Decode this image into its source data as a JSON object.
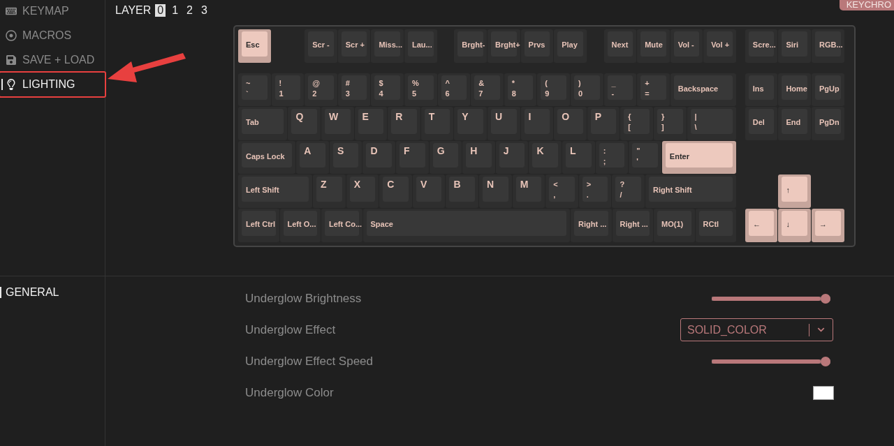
{
  "sidebar": {
    "items": [
      {
        "label": "KEYMAP",
        "selected": false,
        "annotated": false
      },
      {
        "label": "MACROS",
        "selected": false,
        "annotated": false
      },
      {
        "label": "SAVE + LOAD",
        "selected": false,
        "annotated": false
      },
      {
        "label": "LIGHTING",
        "selected": true,
        "annotated": true
      }
    ]
  },
  "layer_picker": {
    "label": "LAYER",
    "layers": [
      {
        "label": "0",
        "selected": true
      },
      {
        "label": "1",
        "selected": false
      },
      {
        "label": "2",
        "selected": false
      },
      {
        "label": "3",
        "selected": false
      }
    ]
  },
  "badge": "KEYCHRO",
  "keyboard": {
    "keys": [
      {
        "kind": "text",
        "legend": "Esc",
        "accent": true
      },
      {
        "kind": "text",
        "legend": "Scr -",
        "accent": false
      },
      {
        "kind": "text",
        "legend": "Scr +",
        "accent": false
      },
      {
        "kind": "text",
        "legend": "Miss...",
        "accent": false
      },
      {
        "kind": "text",
        "legend": "Lau...",
        "accent": false
      },
      {
        "kind": "text",
        "legend": "Brght-",
        "accent": false
      },
      {
        "kind": "text",
        "legend": "Brght+",
        "accent": false
      },
      {
        "kind": "text",
        "legend": "Prvs",
        "accent": false
      },
      {
        "kind": "text",
        "legend": "Play",
        "accent": false
      },
      {
        "kind": "text",
        "legend": "Next",
        "accent": false
      },
      {
        "kind": "text",
        "legend": "Mute",
        "accent": false
      },
      {
        "kind": "text",
        "legend": "Vol -",
        "accent": false
      },
      {
        "kind": "text",
        "legend": "Vol +",
        "accent": false
      },
      {
        "kind": "text",
        "legend": "Scre...",
        "accent": false
      },
      {
        "kind": "text",
        "legend": "Siri",
        "accent": false
      },
      {
        "kind": "text",
        "legend": "RGB...",
        "accent": false
      },
      {
        "kind": "dual",
        "shift": "~",
        "legend": "`",
        "accent": false
      },
      {
        "kind": "dual",
        "shift": "!",
        "legend": "1",
        "accent": false
      },
      {
        "kind": "dual",
        "shift": "@",
        "legend": "2",
        "accent": false
      },
      {
        "kind": "dual",
        "shift": "#",
        "legend": "3",
        "accent": false
      },
      {
        "kind": "dual",
        "shift": "$",
        "legend": "4",
        "accent": false
      },
      {
        "kind": "dual",
        "shift": "%",
        "legend": "5",
        "accent": false
      },
      {
        "kind": "dual",
        "shift": "^",
        "legend": "6",
        "accent": false
      },
      {
        "kind": "dual",
        "shift": "&",
        "legend": "7",
        "accent": false
      },
      {
        "kind": "dual",
        "shift": "*",
        "legend": "8",
        "accent": false
      },
      {
        "kind": "dual",
        "shift": "(",
        "legend": "9",
        "accent": false
      },
      {
        "kind": "dual",
        "shift": ")",
        "legend": "0",
        "accent": false
      },
      {
        "kind": "dual",
        "shift": "_",
        "legend": "-",
        "accent": false
      },
      {
        "kind": "dual",
        "shift": "+",
        "legend": "=",
        "accent": false
      },
      {
        "kind": "text",
        "legend": "Backspace",
        "accent": false
      },
      {
        "kind": "text",
        "legend": "Ins",
        "accent": false
      },
      {
        "kind": "text",
        "legend": "Home",
        "accent": false
      },
      {
        "kind": "text",
        "legend": "PgUp",
        "accent": false
      },
      {
        "kind": "text",
        "legend": "Tab",
        "accent": false
      },
      {
        "kind": "letter",
        "legend": "Q",
        "accent": false
      },
      {
        "kind": "letter",
        "legend": "W",
        "accent": false
      },
      {
        "kind": "letter",
        "legend": "E",
        "accent": false
      },
      {
        "kind": "letter",
        "legend": "R",
        "accent": false
      },
      {
        "kind": "letter",
        "legend": "T",
        "accent": false
      },
      {
        "kind": "letter",
        "legend": "Y",
        "accent": false
      },
      {
        "kind": "letter",
        "legend": "U",
        "accent": false
      },
      {
        "kind": "letter",
        "legend": "I",
        "accent": false
      },
      {
        "kind": "letter",
        "legend": "O",
        "accent": false
      },
      {
        "kind": "letter",
        "legend": "P",
        "accent": false
      },
      {
        "kind": "dual",
        "shift": "{",
        "legend": "[",
        "accent": false
      },
      {
        "kind": "dual",
        "shift": "}",
        "legend": "]",
        "accent": false
      },
      {
        "kind": "dual",
        "shift": "|",
        "legend": "\\",
        "accent": false
      },
      {
        "kind": "text",
        "legend": "Del",
        "accent": false
      },
      {
        "kind": "text",
        "legend": "End",
        "accent": false
      },
      {
        "kind": "text",
        "legend": "PgDn",
        "accent": false
      },
      {
        "kind": "text",
        "legend": "Caps Lock",
        "accent": false
      },
      {
        "kind": "letter",
        "legend": "A",
        "accent": false
      },
      {
        "kind": "letter",
        "legend": "S",
        "accent": false
      },
      {
        "kind": "letter",
        "legend": "D",
        "accent": false
      },
      {
        "kind": "letter",
        "legend": "F",
        "accent": false
      },
      {
        "kind": "letter",
        "legend": "G",
        "accent": false
      },
      {
        "kind": "letter",
        "legend": "H",
        "accent": false
      },
      {
        "kind": "letter",
        "legend": "J",
        "accent": false
      },
      {
        "kind": "letter",
        "legend": "K",
        "accent": false
      },
      {
        "kind": "letter",
        "legend": "L",
        "accent": false
      },
      {
        "kind": "dual",
        "shift": ":",
        "legend": ";",
        "accent": false
      },
      {
        "kind": "dual",
        "shift": "\"",
        "legend": "'",
        "accent": false
      },
      {
        "kind": "text",
        "legend": "Enter",
        "accent": true
      },
      {
        "kind": "text",
        "legend": "Left Shift",
        "accent": false
      },
      {
        "kind": "letter",
        "legend": "Z",
        "accent": false
      },
      {
        "kind": "letter",
        "legend": "X",
        "accent": false
      },
      {
        "kind": "letter",
        "legend": "C",
        "accent": false
      },
      {
        "kind": "letter",
        "legend": "V",
        "accent": false
      },
      {
        "kind": "letter",
        "legend": "B",
        "accent": false
      },
      {
        "kind": "letter",
        "legend": "N",
        "accent": false
      },
      {
        "kind": "letter",
        "legend": "M",
        "accent": false
      },
      {
        "kind": "dual",
        "shift": "<",
        "legend": ",",
        "accent": false
      },
      {
        "kind": "dual",
        "shift": ">",
        "legend": ".",
        "accent": false
      },
      {
        "kind": "dual",
        "shift": "?",
        "legend": "/",
        "accent": false
      },
      {
        "kind": "text",
        "legend": "Right Shift",
        "accent": false
      },
      {
        "kind": "text",
        "legend": "↑",
        "accent": true
      },
      {
        "kind": "text",
        "legend": "Left Ctrl",
        "accent": false
      },
      {
        "kind": "text",
        "legend": "Left O...",
        "accent": false
      },
      {
        "kind": "text",
        "legend": "Left Co...",
        "accent": false
      },
      {
        "kind": "text",
        "legend": "Space",
        "accent": false
      },
      {
        "kind": "text",
        "legend": "Right ...",
        "accent": false
      },
      {
        "kind": "text",
        "legend": "Right ...",
        "accent": false
      },
      {
        "kind": "text",
        "legend": "MO(1)",
        "accent": false
      },
      {
        "kind": "text",
        "legend": "RCtl",
        "accent": false
      },
      {
        "kind": "text",
        "legend": "←",
        "accent": true
      },
      {
        "kind": "text",
        "legend": "↓",
        "accent": true
      },
      {
        "kind": "text",
        "legend": "→",
        "accent": true
      }
    ]
  },
  "lower_sidebar": {
    "items": [
      {
        "label": "GENERAL",
        "selected": true
      }
    ]
  },
  "settings": [
    {
      "kind": "slider",
      "label": "Underglow Brightness",
      "level": 1
    },
    {
      "kind": "select",
      "label": "Underglow Effect",
      "value": "SOLID_COLOR"
    },
    {
      "kind": "slider",
      "label": "Underglow Effect Speed",
      "level": 1
    },
    {
      "kind": "color",
      "label": "Underglow Color",
      "color": "#ffffff"
    }
  ]
}
